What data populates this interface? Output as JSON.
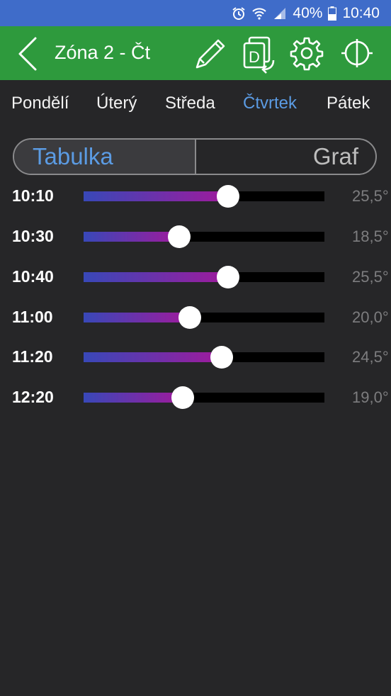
{
  "status_bar": {
    "battery": "40%",
    "time": "10:40",
    "icons": [
      "alarm-icon",
      "wifi-icon",
      "signal-icon",
      "battery-icon"
    ]
  },
  "app_bar": {
    "title": "Zóna 2 - Čt",
    "icons": [
      "back-arrow-icon",
      "pencil-icon",
      "copy-day-icon",
      "gear-icon",
      "power-icon"
    ],
    "copy_icon_letter": "D"
  },
  "days": {
    "items": [
      "Pondělí",
      "Úterý",
      "Středa",
      "Čtvrtek",
      "Pátek"
    ],
    "selected": "Čtvrtek"
  },
  "view_toggle": {
    "table": "Tabulka",
    "graph": "Graf",
    "selected": "Tabulka"
  },
  "schedule": [
    {
      "time": "10:10",
      "temp": "25,5°",
      "level": 0.6
    },
    {
      "time": "10:30",
      "temp": "18,5°",
      "level": 0.397
    },
    {
      "time": "10:40",
      "temp": "25,5°",
      "level": 0.6
    },
    {
      "time": "11:00",
      "temp": "20,0°",
      "level": 0.441
    },
    {
      "time": "11:20",
      "temp": "24,5°",
      "level": 0.574
    },
    {
      "time": "12:20",
      "temp": "19,0°",
      "level": 0.412
    }
  ],
  "colors": {
    "status_bar": "#3f6cc9",
    "app_bar": "#2e9a3d",
    "background": "#262628",
    "accent": "#5b9be3",
    "slider_start": "#3848b8",
    "slider_end": "#a01a9c"
  }
}
